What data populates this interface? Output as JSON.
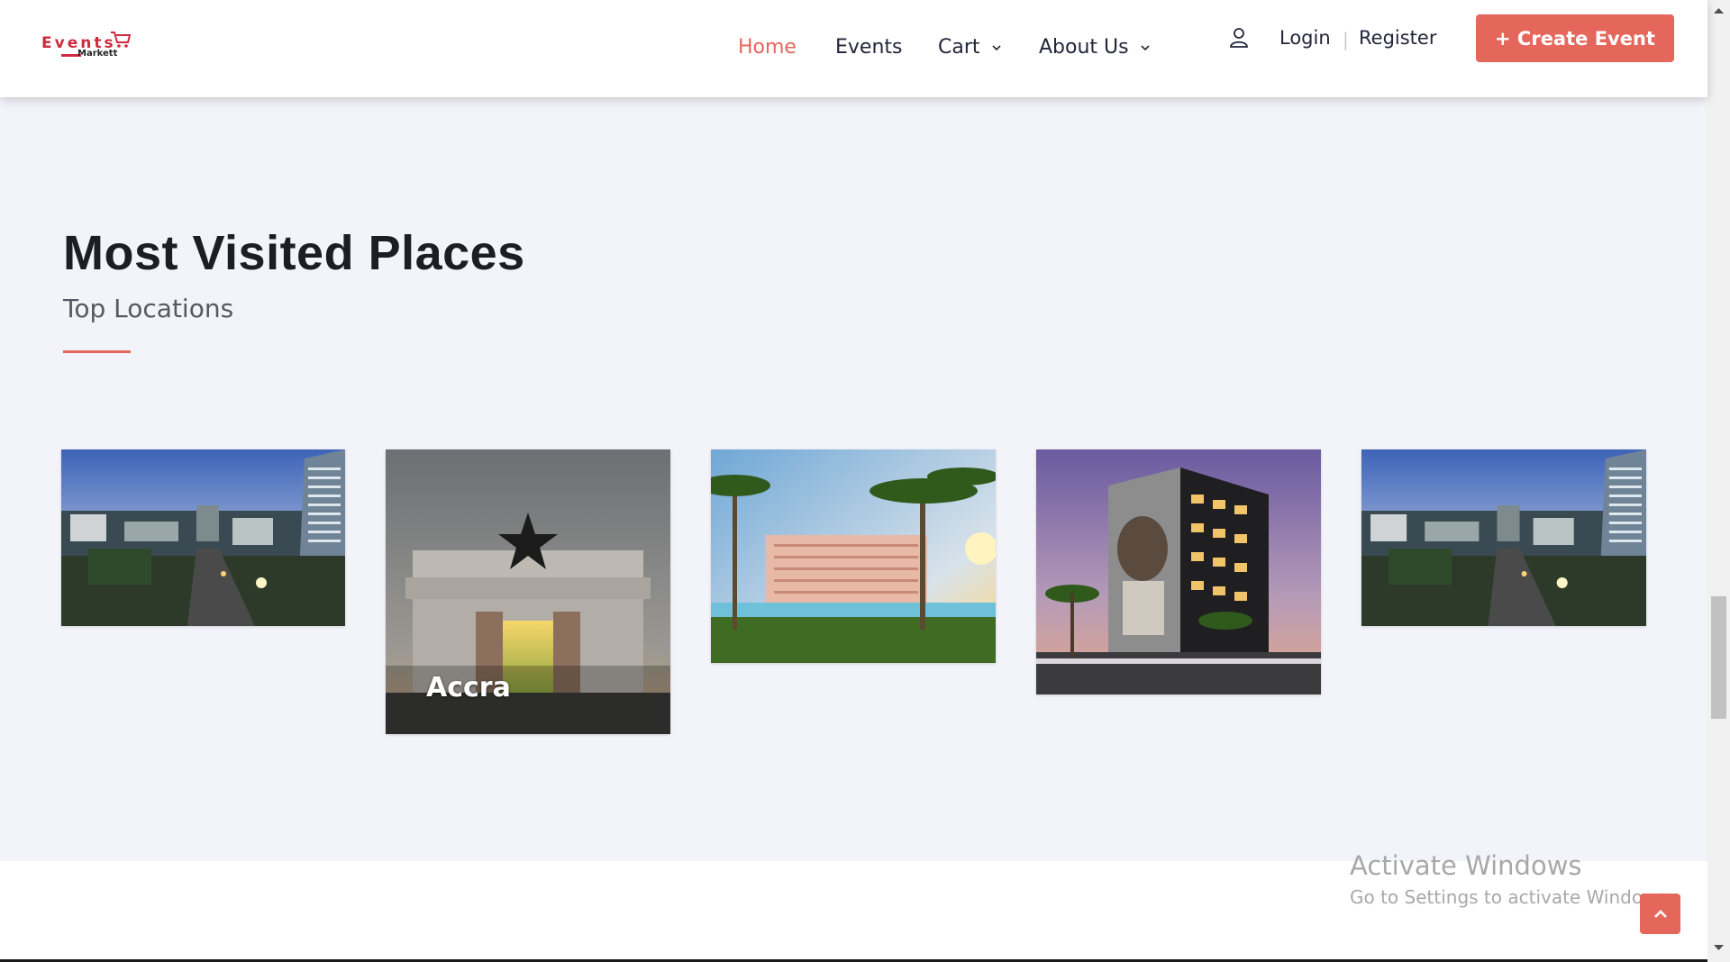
{
  "brand": {
    "logo_word": "Events",
    "logo_sub": "Markett"
  },
  "nav": {
    "items": [
      {
        "label": "Home",
        "active": true
      },
      {
        "label": "Events",
        "active": false
      },
      {
        "label": "Cart",
        "has_dropdown": true
      },
      {
        "label": "About Us",
        "has_dropdown": true
      }
    ]
  },
  "auth": {
    "login_label": "Login",
    "separator": "|",
    "register_label": "Register"
  },
  "create_event": {
    "label": "+ Create Event"
  },
  "section": {
    "title": "Most Visited Places",
    "subtitle": "Top Locations",
    "cards": [
      {
        "label": "",
        "image": "city-skyline-dusk-photo"
      },
      {
        "label": "Accra",
        "image": "independence-arch-photo"
      },
      {
        "label": "",
        "image": "palm-resort-hotel-photo"
      },
      {
        "label": "",
        "image": "mural-building-night-photo"
      },
      {
        "label": "",
        "image": "city-skyline-dusk-photo"
      }
    ]
  },
  "windows_watermark": {
    "title": "Activate Windows",
    "subtitle": "Go to Settings to activate Windows."
  },
  "icons": {
    "user": "user-icon",
    "caret": "chevron-down-icon",
    "scroll_top": "chevron-up-icon"
  },
  "colors": {
    "accent": "#e5675c",
    "page_bg": "#f3f3fa",
    "text_dark": "#23263a"
  }
}
